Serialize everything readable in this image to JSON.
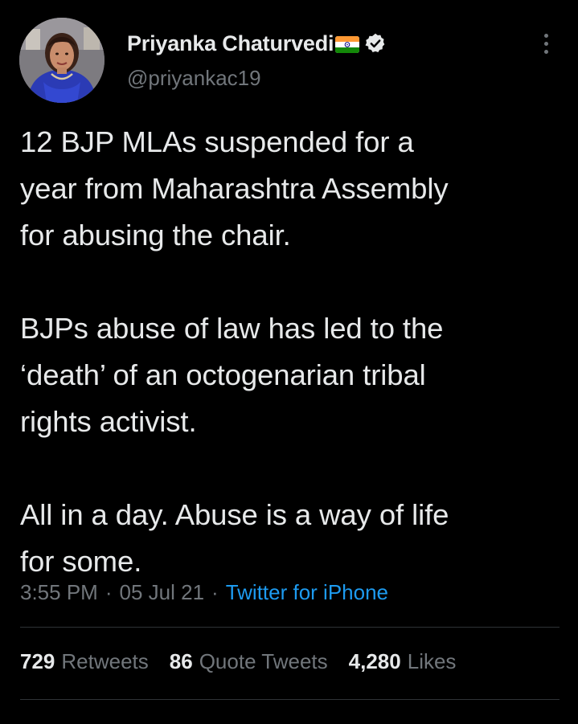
{
  "author": {
    "display_name": "Priyanka Chaturvedi",
    "handle": "@priyankac19",
    "flag_icon": "india-flag-emoji",
    "verified_icon": "verified-badge-icon"
  },
  "tweet": {
    "paragraphs": [
      "12 BJP MLAs suspended for a\nyear from Maharashtra Assembly\nfor abusing the chair.",
      "BJPs abuse of law has led to the\n‘death’ of an octogenarian tribal\nrights activist.",
      "All in a day. Abuse is a way of life\nfor some."
    ],
    "time": "3:55 PM",
    "date": "05 Jul 21",
    "separator": "·",
    "source": "Twitter for iPhone"
  },
  "stats": {
    "retweets_count": "729",
    "retweets_label": "Retweets",
    "quotes_count": "86",
    "quotes_label": "Quote Tweets",
    "likes_count": "4,280",
    "likes_label": "Likes"
  },
  "colors": {
    "background": "#000000",
    "text_primary": "#e7e9ea",
    "text_secondary": "#71767b",
    "link": "#1d9bf0",
    "divider": "#2f3336"
  }
}
